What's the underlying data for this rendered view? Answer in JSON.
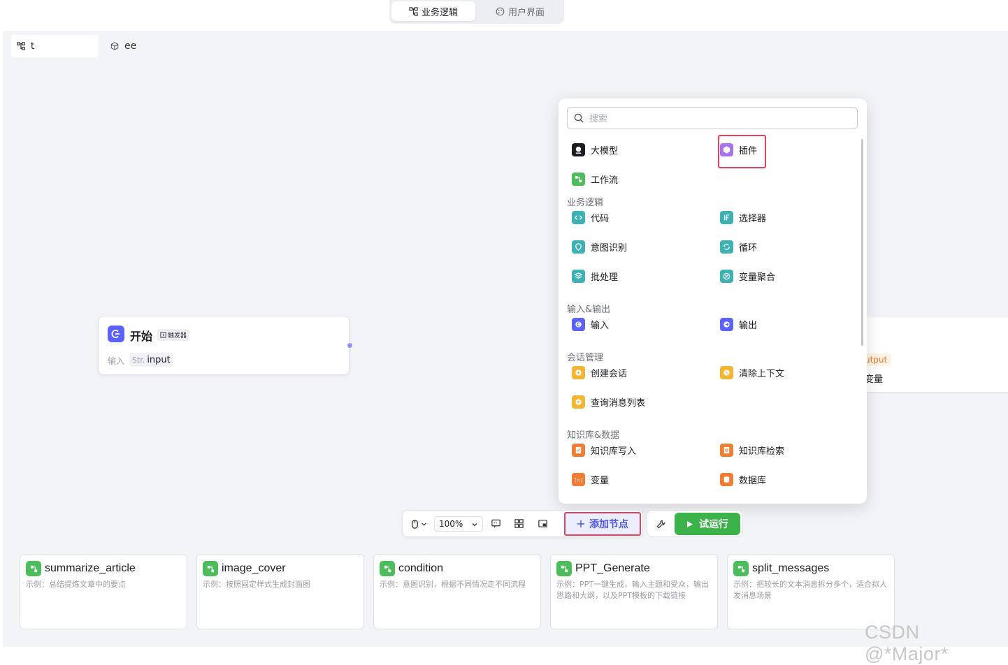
{
  "mode_tabs": [
    {
      "label": "业务逻辑",
      "icon": "workflow-icon",
      "active": true
    },
    {
      "label": "用户界面",
      "icon": "palette-icon",
      "active": false
    }
  ],
  "file_tabs": [
    {
      "label": "t",
      "icon": "workflow-icon",
      "active": true
    },
    {
      "label": "ee",
      "icon": "cube-icon",
      "active": false
    }
  ],
  "start_node": {
    "title": "开始",
    "badge": "触发器",
    "input_label": "输入",
    "input_type": "Str.",
    "input_name": "input"
  },
  "end_node": {
    "output_tag": "utput",
    "var_label": "变量"
  },
  "node_panel": {
    "search_placeholder": "搜索",
    "top_items": [
      {
        "label": "大模型",
        "icon": "llm-icon",
        "color": "#1d1c23"
      },
      {
        "label": "插件",
        "icon": "plugin-icon",
        "color": "#a872f0"
      },
      {
        "label": "工作流",
        "icon": "workflow-icon",
        "color": "#4bbd5b"
      }
    ],
    "sections": [
      {
        "title": "业务逻辑",
        "items": [
          {
            "label": "代码",
            "icon": "code-icon",
            "color": "#3db1b4"
          },
          {
            "label": "选择器",
            "icon": "if-icon",
            "color": "#3db1b4"
          },
          {
            "label": "意图识别",
            "icon": "intent-icon",
            "color": "#3db1b4"
          },
          {
            "label": "循环",
            "icon": "loop-icon",
            "color": "#3db1b4"
          },
          {
            "label": "批处理",
            "icon": "batch-icon",
            "color": "#3db1b4"
          },
          {
            "label": "变量聚合",
            "icon": "aggregate-icon",
            "color": "#3db1b4"
          }
        ]
      },
      {
        "title": "输入&输出",
        "items": [
          {
            "label": "输入",
            "icon": "input-icon",
            "color": "#5c62ff"
          },
          {
            "label": "输出",
            "icon": "output-icon",
            "color": "#5c62ff"
          }
        ]
      },
      {
        "title": "会话管理",
        "items": [
          {
            "label": "创建会话",
            "icon": "create-chat-icon",
            "color": "#f5b533"
          },
          {
            "label": "清除上下文",
            "icon": "clear-context-icon",
            "color": "#f5b533"
          },
          {
            "label": "查询消息列表",
            "icon": "message-list-icon",
            "color": "#f5b533"
          }
        ]
      },
      {
        "title": "知识库&数据",
        "items": [
          {
            "label": "知识库写入",
            "icon": "kb-write-icon",
            "color": "#f07d33"
          },
          {
            "label": "知识库检索",
            "icon": "kb-search-icon",
            "color": "#f07d33"
          },
          {
            "label": "变量",
            "icon": "variable-icon",
            "color": "#f07d33"
          },
          {
            "label": "数据库",
            "icon": "database-icon",
            "color": "#f07d33"
          }
        ]
      }
    ]
  },
  "toolbar": {
    "zoom": "100%",
    "add_node_label": "添加节点",
    "run_label": "试运行"
  },
  "template_cards": [
    {
      "title": "summarize_article",
      "desc": "示例：总结提炼文章中的要点"
    },
    {
      "title": "image_cover",
      "desc": "示例：按照固定样式生成封面图"
    },
    {
      "title": "condition",
      "desc": "示例：意图识别，根据不同情况走不同流程"
    },
    {
      "title": "PPT_Generate",
      "desc": "示例：PPT一键生成，输入主题和受众，输出思路和大纲，以及PPT模板的下载链接"
    },
    {
      "title": "split_messages",
      "desc": "示例：把较长的文本消息拆分多个，适合拟人发消息场景"
    }
  ],
  "watermark": "CSDN @*Major*",
  "colors": {
    "accent": "#4d53e8",
    "highlight": "#e8405a",
    "run": "#3bb34a"
  }
}
